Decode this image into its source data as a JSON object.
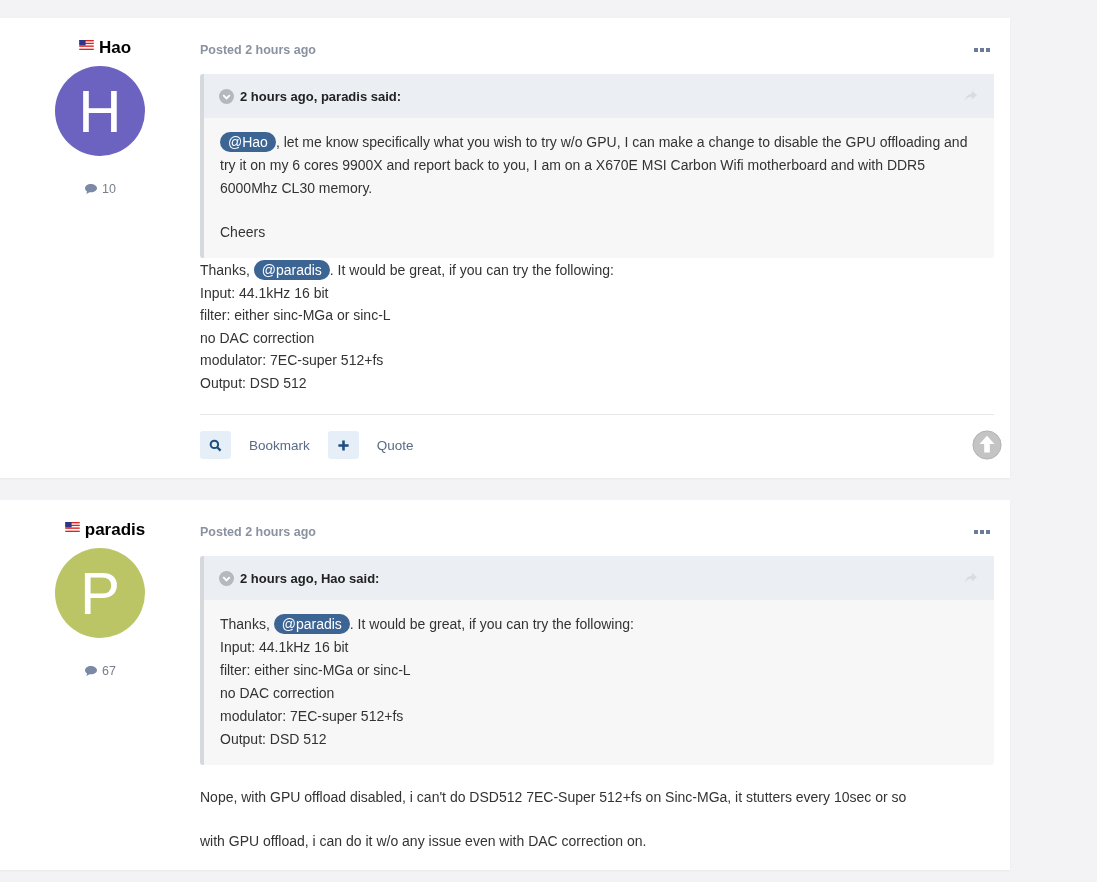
{
  "posts": [
    {
      "author": "Hao",
      "avatar": {
        "letter": "H",
        "color": "#6c63c0"
      },
      "post_count": "10",
      "posted": "Posted 2 hours ago",
      "quote": {
        "header": "2 hours ago, paradis said:",
        "paragraphs": [
          [
            [
              {
                "kind": "mention",
                "text": "@Hao"
              },
              {
                "kind": "text",
                "text": ", let me know specifically what you wish to try w/o GPU, I can make a change to disable the GPU offloading and try it on my 6 cores 9900X and report back to you, I am on a X670E MSI Carbon Wifi motherboard and with DDR5 6000Mhz CL30 memory."
              }
            ]
          ],
          [
            [
              {
                "kind": "text",
                "text": "Cheers"
              }
            ]
          ]
        ]
      },
      "body": [
        [
          [
            {
              "kind": "text",
              "text": "Thanks, "
            },
            {
              "kind": "mention",
              "text": "@paradis"
            },
            {
              "kind": "text",
              "text": ".  It would be great, if you can try the following:"
            }
          ],
          [
            {
              "kind": "text",
              "text": "Input: 44.1kHz 16 bit"
            }
          ],
          [
            {
              "kind": "text",
              "text": "filter: either sinc-MGa or sinc-L"
            }
          ],
          [
            {
              "kind": "text",
              "text": "no DAC correction"
            }
          ],
          [
            {
              "kind": "text",
              "text": "modulator: 7EC-super 512+fs"
            }
          ],
          [
            {
              "kind": "text",
              "text": "Output: DSD 512"
            }
          ]
        ]
      ],
      "actions": [
        {
          "kind": "search",
          "label": "Bookmark"
        },
        {
          "kind": "plus",
          "label": "Quote"
        }
      ]
    },
    {
      "author": "paradis",
      "avatar": {
        "letter": "P",
        "color": "#bcc565"
      },
      "post_count": "67",
      "posted": "Posted 2 hours ago",
      "quote": {
        "header": "2 hours ago, Hao said:",
        "paragraphs": [
          [
            [
              {
                "kind": "text",
                "text": "Thanks, "
              },
              {
                "kind": "mention",
                "text": "@paradis"
              },
              {
                "kind": "text",
                "text": ".  It would be great, if you can try the following:"
              }
            ],
            [
              {
                "kind": "text",
                "text": "Input: 44.1kHz 16 bit"
              }
            ],
            [
              {
                "kind": "text",
                "text": "filter: either sinc-MGa or sinc-L"
              }
            ],
            [
              {
                "kind": "text",
                "text": "no DAC correction"
              }
            ],
            [
              {
                "kind": "text",
                "text": "modulator: 7EC-super 512+fs"
              }
            ],
            [
              {
                "kind": "text",
                "text": "Output: DSD 512"
              }
            ]
          ]
        ]
      },
      "body": [
        [
          [
            {
              "kind": "text",
              "text": "Nope, with GPU offload disabled, i can't do DSD512 7EC-Super 512+fs on Sinc-MGa, it stutters every 10sec or so"
            }
          ]
        ],
        [
          [
            {
              "kind": "text",
              "text": "with GPU offload, i can do it w/o any issue even with DAC correction on."
            }
          ]
        ]
      ]
    }
  ]
}
